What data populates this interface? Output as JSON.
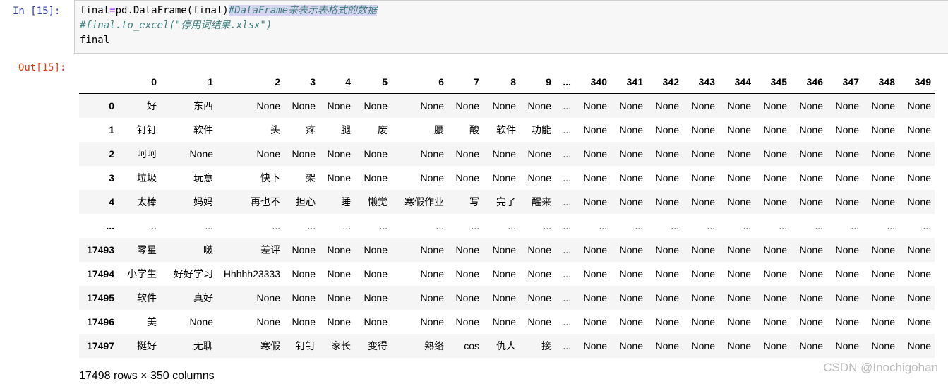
{
  "input_cell": {
    "prompt": "In  [15]:",
    "line1_code": "final",
    "line1_op": "=",
    "line1_call": "pd.DataFrame(final)",
    "line1_comment": "#DataFrame来表示表格式的数据",
    "line2_comment": "#final.to_excel(\"停用词结果.xlsx\")",
    "line3": "final"
  },
  "output_cell": {
    "prompt": "Out[15]:",
    "columns": [
      "",
      "0",
      "1",
      "2",
      "3",
      "4",
      "5",
      "6",
      "7",
      "8",
      "9",
      "...",
      "340",
      "341",
      "342",
      "343",
      "344",
      "345",
      "346",
      "347",
      "348",
      "349"
    ],
    "rows": [
      {
        "index": "0",
        "cells": [
          "好",
          "东西",
          "None",
          "None",
          "None",
          "None",
          "None",
          "None",
          "None",
          "None",
          "...",
          "None",
          "None",
          "None",
          "None",
          "None",
          "None",
          "None",
          "None",
          "None",
          "None"
        ]
      },
      {
        "index": "1",
        "cells": [
          "钉钉",
          "软件",
          "头",
          "疼",
          "腿",
          "废",
          "腰",
          "酸",
          "软件",
          "功能",
          "...",
          "None",
          "None",
          "None",
          "None",
          "None",
          "None",
          "None",
          "None",
          "None",
          "None"
        ]
      },
      {
        "index": "2",
        "cells": [
          "呵呵",
          "None",
          "None",
          "None",
          "None",
          "None",
          "None",
          "None",
          "None",
          "None",
          "...",
          "None",
          "None",
          "None",
          "None",
          "None",
          "None",
          "None",
          "None",
          "None",
          "None"
        ]
      },
      {
        "index": "3",
        "cells": [
          "垃圾",
          "玩意",
          "快下",
          "架",
          "None",
          "None",
          "None",
          "None",
          "None",
          "None",
          "...",
          "None",
          "None",
          "None",
          "None",
          "None",
          "None",
          "None",
          "None",
          "None",
          "None"
        ]
      },
      {
        "index": "4",
        "cells": [
          "太棒",
          "妈妈",
          "再也不",
          "担心",
          "睡",
          "懒觉",
          "寒假作业",
          "写",
          "完了",
          "醒来",
          "...",
          "None",
          "None",
          "None",
          "None",
          "None",
          "None",
          "None",
          "None",
          "None",
          "None"
        ]
      },
      {
        "index": "...",
        "cells": [
          "...",
          "...",
          "...",
          "...",
          "...",
          "...",
          "...",
          "...",
          "...",
          "...",
          "...",
          "...",
          "...",
          "...",
          "...",
          "...",
          "...",
          "...",
          "...",
          "...",
          "..."
        ]
      },
      {
        "index": "17493",
        "cells": [
          "零星",
          "啵",
          "差评",
          "None",
          "None",
          "None",
          "None",
          "None",
          "None",
          "None",
          "...",
          "None",
          "None",
          "None",
          "None",
          "None",
          "None",
          "None",
          "None",
          "None",
          "None"
        ]
      },
      {
        "index": "17494",
        "cells": [
          "小学生",
          "好好学习",
          "Hhhhh23333",
          "None",
          "None",
          "None",
          "None",
          "None",
          "None",
          "None",
          "...",
          "None",
          "None",
          "None",
          "None",
          "None",
          "None",
          "None",
          "None",
          "None",
          "None"
        ]
      },
      {
        "index": "17495",
        "cells": [
          "软件",
          "真好",
          "None",
          "None",
          "None",
          "None",
          "None",
          "None",
          "None",
          "None",
          "...",
          "None",
          "None",
          "None",
          "None",
          "None",
          "None",
          "None",
          "None",
          "None",
          "None"
        ]
      },
      {
        "index": "17496",
        "cells": [
          "美",
          "None",
          "None",
          "None",
          "None",
          "None",
          "None",
          "None",
          "None",
          "None",
          "...",
          "None",
          "None",
          "None",
          "None",
          "None",
          "None",
          "None",
          "None",
          "None",
          "None"
        ]
      },
      {
        "index": "17497",
        "cells": [
          "挺好",
          "无聊",
          "寒假",
          "钉钉",
          "家长",
          "变得",
          "熟络",
          "cos",
          "仇人",
          "接",
          "...",
          "None",
          "None",
          "None",
          "None",
          "None",
          "None",
          "None",
          "None",
          "None",
          "None"
        ]
      }
    ],
    "footer": "17498 rows × 350 columns"
  },
  "watermark": "CSDN @Inochigohan"
}
